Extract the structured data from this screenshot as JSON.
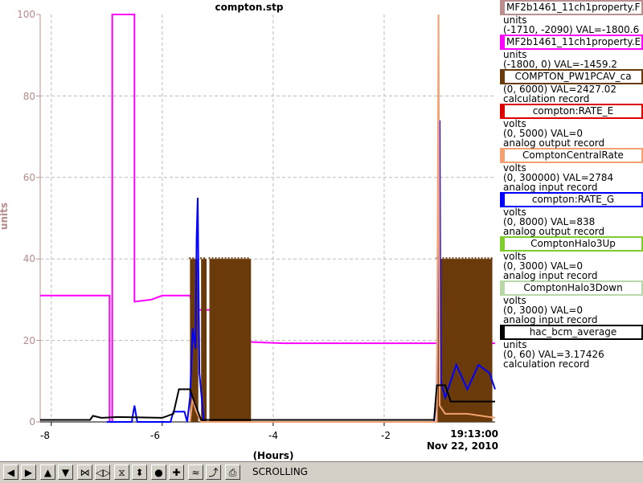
{
  "window": {
    "title": "compton.stp"
  },
  "axes": {
    "ylabel": "units",
    "xlabel": "(Hours)",
    "y_ticks": [
      "0",
      "20",
      "40",
      "60",
      "80",
      "100"
    ],
    "x_ticks": [
      "-8",
      "-6",
      "-4",
      "-2"
    ],
    "time": "19:13:00",
    "date": "Nov 22, 2010"
  },
  "legend": [
    {
      "name": "MF2b1461_11ch1property.F",
      "color": "#bc8f8f",
      "lines": [
        "units",
        "(-1710, -2090) VAL=-1800.6"
      ]
    },
    {
      "name": "MF2b1461_11ch1property.E",
      "color": "#ff00ff",
      "lines": [
        "units",
        "(-1800, 0) VAL=-1459.2"
      ]
    },
    {
      "name": "COMPTON_PW1PCAV_ca",
      "color": "#6b3a0a",
      "lines": [
        "(0, 6000) VAL=2427.02",
        "calculation record"
      ]
    },
    {
      "name": "compton:RATE_E",
      "color": "#dd0000",
      "lines": [
        "volts",
        "(0, 5000) VAL=0",
        "analog output record"
      ]
    },
    {
      "name": "ComptonCentralRate",
      "color": "#f4a070",
      "lines": [
        "volts",
        "(0, 300000) VAL=2784",
        "analog input record"
      ]
    },
    {
      "name": "compton:RATE_G",
      "color": "#0000ff",
      "lines": [
        "volts",
        "(0, 8000) VAL=838",
        "analog output record"
      ]
    },
    {
      "name": "ComptonHalo3Up",
      "color": "#7fcc2f",
      "lines": [
        "volts",
        "(0, 3000) VAL=0",
        "analog input record"
      ]
    },
    {
      "name": "ComptonHalo3Down",
      "color": "#b8d8a8",
      "lines": [
        "volts",
        "(0, 3000) VAL=0",
        "analog input record"
      ]
    },
    {
      "name": "hac_bcm_average",
      "color": "#000000",
      "lines": [
        "units",
        "(0, 60) VAL=3.17426",
        "calculation record"
      ]
    }
  ],
  "toolbar": {
    "status": "SCROLLING",
    "buttons": [
      {
        "name": "scroll-left-icon",
        "glyph": "◀"
      },
      {
        "name": "scroll-right-icon",
        "glyph": "▶"
      },
      {
        "name": "scroll-up-icon",
        "glyph": "▲"
      },
      {
        "name": "scroll-down-icon",
        "glyph": "▼"
      },
      {
        "name": "zoom-in-horizontal-icon",
        "glyph": "⋈"
      },
      {
        "name": "zoom-out-horizontal-icon",
        "glyph": "◁▷"
      },
      {
        "name": "zoom-in-vertical-icon",
        "glyph": "⧖"
      },
      {
        "name": "zoom-out-vertical-icon",
        "glyph": "⬍"
      },
      {
        "name": "record-icon",
        "glyph": "●"
      },
      {
        "name": "add-icon",
        "glyph": "✚"
      },
      {
        "name": "strip-mode-icon",
        "glyph": "≈"
      },
      {
        "name": "export-icon",
        "glyph": "⤴"
      },
      {
        "name": "print-icon",
        "glyph": "⎙"
      }
    ]
  },
  "chart_data": {
    "type": "line",
    "title": "compton.stp",
    "xlabel": "(Hours)",
    "ylabel": "units",
    "xlim": [
      -8.2,
      0
    ],
    "ylim": [
      0,
      100
    ],
    "grid": true,
    "series": [
      {
        "name": "MF2b1461_11ch1property.E",
        "color": "#ff00ff",
        "points": [
          [
            -8.2,
            31
          ],
          [
            -6.95,
            31
          ],
          [
            -6.95,
            0
          ],
          [
            -6.9,
            0
          ],
          [
            -6.9,
            100
          ],
          [
            -6.5,
            100
          ],
          [
            -6.5,
            29.5
          ],
          [
            -6.2,
            30
          ],
          [
            -6.0,
            31
          ],
          [
            -5.5,
            31
          ],
          [
            -5.45,
            27.5
          ],
          [
            -5.1,
            27.5
          ],
          [
            -5.05,
            20
          ],
          [
            -4.2,
            19.5
          ],
          [
            -3.8,
            19.3
          ],
          [
            -1.0,
            19.3
          ],
          [
            0,
            19.3
          ]
        ]
      },
      {
        "name": "COMPTON_PW1PCAV_ca",
        "color": "#6b3a0a",
        "bands": [
          [
            -5.5,
            -5.35,
            40
          ],
          [
            -5.3,
            -5.2,
            40
          ],
          [
            -5.15,
            -4.4,
            40
          ],
          [
            -1.05,
            -0.05,
            40
          ]
        ]
      },
      {
        "name": "compton:RATE_G",
        "color": "#0000ff",
        "points": [
          [
            -7.0,
            0
          ],
          [
            -6.55,
            0
          ],
          [
            -6.5,
            4
          ],
          [
            -6.45,
            0
          ],
          [
            -5.85,
            0
          ],
          [
            -5.8,
            2.5
          ],
          [
            -5.6,
            2.5
          ],
          [
            -5.55,
            0
          ],
          [
            -5.5,
            6
          ],
          [
            -5.45,
            23
          ],
          [
            -5.4,
            18
          ],
          [
            -5.38,
            45
          ],
          [
            -5.36,
            55
          ],
          [
            -5.33,
            12
          ],
          [
            -5.25,
            0
          ],
          [
            -1.1,
            0
          ],
          [
            -1.05,
            8
          ],
          [
            -1.0,
            74
          ],
          [
            -0.98,
            10
          ],
          [
            -0.9,
            6
          ],
          [
            -0.7,
            14
          ],
          [
            -0.5,
            8
          ],
          [
            -0.3,
            14
          ],
          [
            -0.1,
            12
          ],
          [
            0,
            8
          ]
        ]
      },
      {
        "name": "ComptonCentralRate",
        "color": "#f4a070",
        "points": [
          [
            -5.5,
            0
          ],
          [
            -5.45,
            6
          ],
          [
            -5.4,
            3
          ],
          [
            -5.3,
            0
          ],
          [
            -1.05,
            0
          ],
          [
            -1.02,
            100
          ],
          [
            -1.0,
            4
          ],
          [
            -0.9,
            2
          ],
          [
            -0.5,
            2
          ],
          [
            0,
            1
          ]
        ]
      },
      {
        "name": "hac_bcm_average",
        "color": "#000000",
        "points": [
          [
            -8.2,
            0.5
          ],
          [
            -7.3,
            0.5
          ],
          [
            -7.25,
            1.5
          ],
          [
            -7.1,
            1
          ],
          [
            -6.8,
            1.2
          ],
          [
            -6.0,
            1
          ],
          [
            -5.8,
            2
          ],
          [
            -5.7,
            8
          ],
          [
            -5.5,
            8
          ],
          [
            -5.45,
            6
          ],
          [
            -5.3,
            0.5
          ],
          [
            -1.1,
            0.5
          ],
          [
            -1.05,
            9
          ],
          [
            -0.9,
            9
          ],
          [
            -0.8,
            5
          ],
          [
            0,
            5
          ]
        ]
      }
    ]
  }
}
